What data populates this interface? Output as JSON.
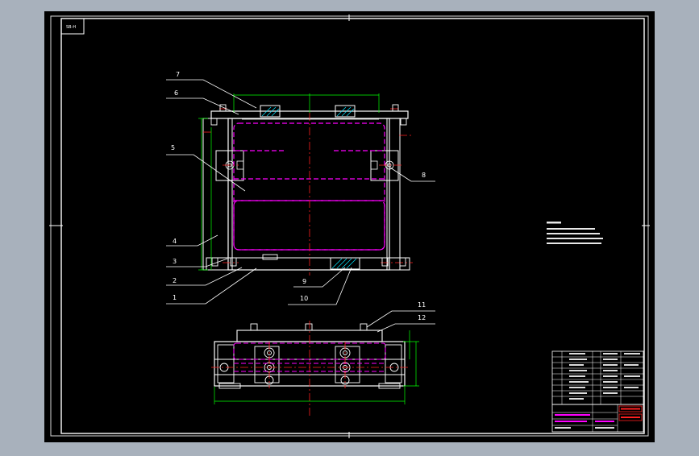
{
  "title_block": {
    "tag": "SB-H",
    "part_numbers": [
      "1",
      "2",
      "3",
      "4",
      "5",
      "6",
      "7",
      "8",
      "9",
      "10",
      "11",
      "12"
    ]
  },
  "colors": {
    "window_bg": "#a8b1bc",
    "canvas": "#000000",
    "outline": "#ffffff",
    "hidden_line": "#ff00ff",
    "center_line": "#ff0000",
    "dimension": "#00ff00",
    "hatch": "#00ffff",
    "leader": "#ffffff",
    "stamp": "#ff0000"
  }
}
